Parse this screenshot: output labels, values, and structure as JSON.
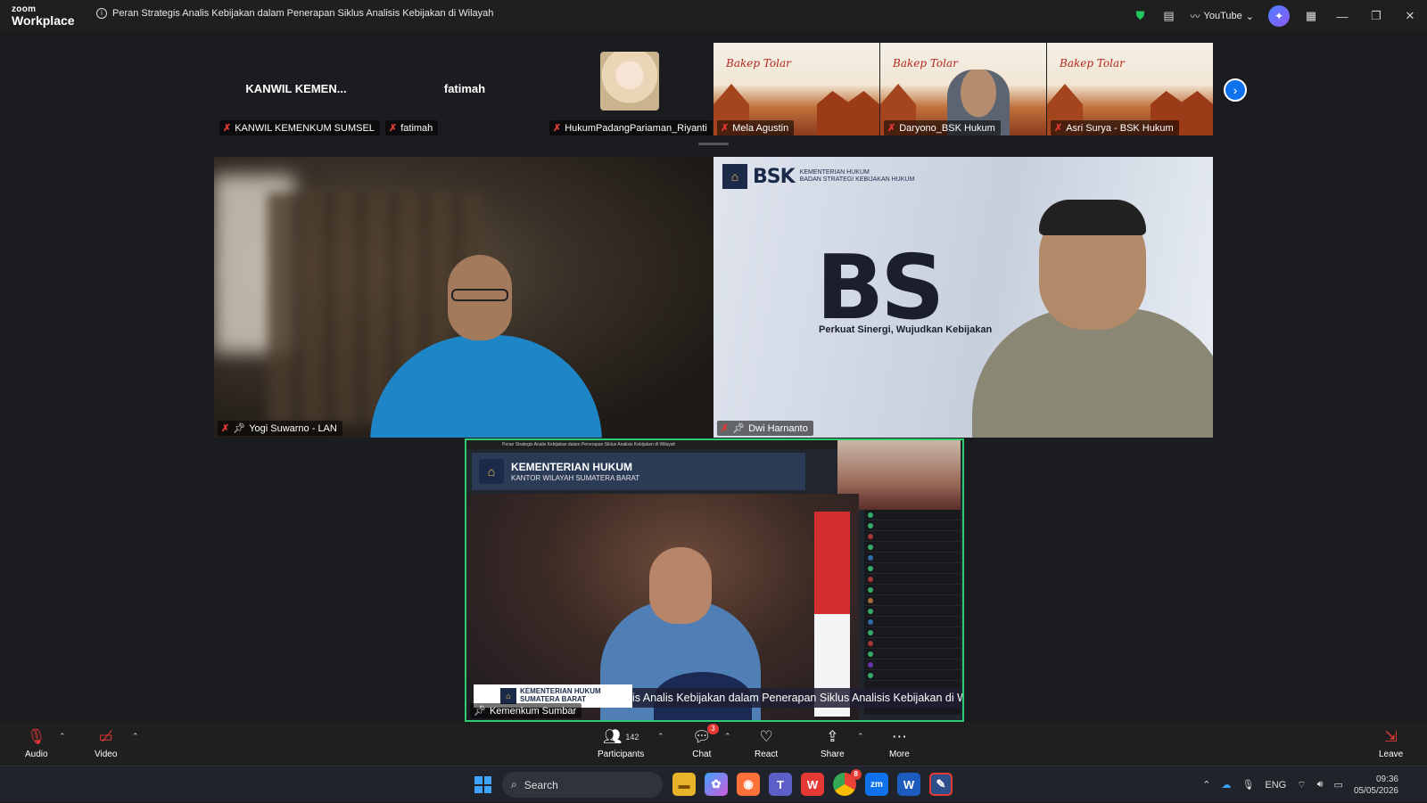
{
  "app": {
    "logo_top": "zoom",
    "logo_bottom": "Workplace",
    "meeting_title": "Peran Strategis Analis Kebijakan dalam Penerapan Siklus Analisis Kebijakan di Wilayah",
    "youtube_label": "YouTube"
  },
  "thumbnails": [
    {
      "big_name": "KANWIL KEMEN...",
      "label": "KANWIL KEMENKUM SUMSEL"
    },
    {
      "big_name": "fatimah",
      "label": "fatimah"
    },
    {
      "label": "HukumPadangPariaman_Riyanti"
    },
    {
      "label": "Mela Agustin",
      "slide_text": "Bakep Tolar"
    },
    {
      "label": "Daryono_BSK Hukum",
      "slide_text": "Bakep Tolar"
    },
    {
      "label": "Asri Surya - BSK Hukum",
      "slide_text": "Bakep Tolar"
    }
  ],
  "tiles": {
    "yogi": {
      "label": "Yogi Suwarno - LAN"
    },
    "dwi": {
      "label": "Dwi Harnanto",
      "bsk_small": "BSK",
      "bsk_sub1": "KEMENTERIAN HUKUM",
      "bsk_sub2": "BADAN STRATEGI KEBIJAKAN HUKUM",
      "bsk_big": "BS",
      "tagline": "Perkuat Sinergi, Wujudkan Kebijakan"
    },
    "sumbar": {
      "label": "Kemenkum Sumbar",
      "header_title": "KEMENTERIAN HUKUM",
      "header_sub": "KANTOR WILAYAH SUMATERA BARAT",
      "banner_line1": "KEMENTERIAN HUKUM",
      "banner_line2": "SUMATERA BARAT",
      "ticker": "is Analis Kebijakan dalam Penerapan Siklus Analisis Kebijakan di Wila"
    }
  },
  "toolbar": {
    "audio": "Audio",
    "video": "Video",
    "participants": "Participants",
    "participants_count": "142",
    "chat": "Chat",
    "chat_badge": "3",
    "react": "React",
    "share": "Share",
    "more": "More",
    "leave": "Leave"
  },
  "taskbar": {
    "search_placeholder": "Search",
    "lang": "ENG",
    "time": "09:36",
    "date": "05/05/2026",
    "chrome_badge": "8"
  },
  "colors": {
    "accent": "#0e72ed",
    "active_speaker_border": "#2ecc71",
    "mic_off": "#e53935"
  }
}
